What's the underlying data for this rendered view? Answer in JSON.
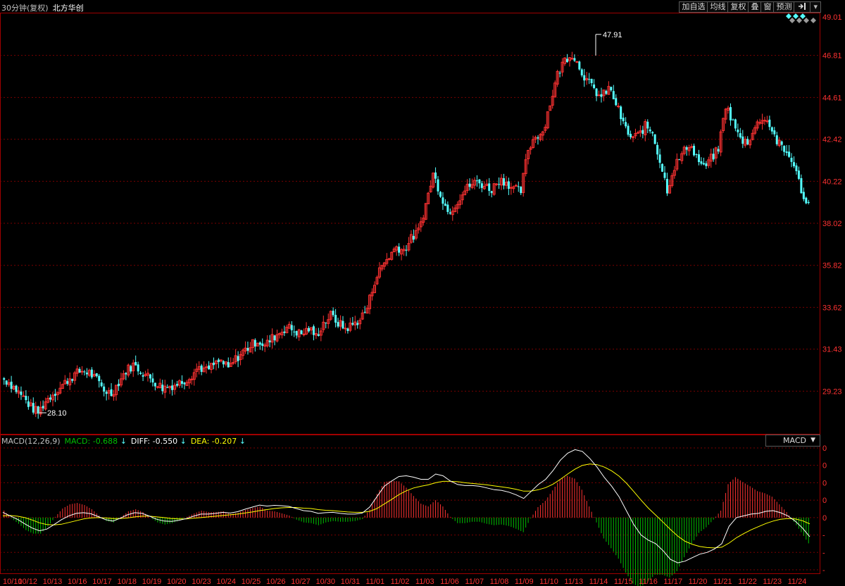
{
  "header": {
    "period": "30分钟(复权)",
    "stock_name": "北方华创",
    "buttons": [
      "加自选",
      "均线",
      "复权",
      "叠",
      "窗",
      "预测"
    ],
    "arrow_icon": "exit-arrow-icon",
    "menu_icon": "dropdown-triangle-icon"
  },
  "colors": {
    "up": "#ff3232",
    "down": "#54ffff",
    "grid": "#7a0000",
    "axis_text": "#ff3232",
    "dates_text": "#ff3232",
    "diff": "#ffffff",
    "dea": "#ffff00",
    "macd_pos": "#ff3232",
    "macd_neg": "#00c000"
  },
  "macd_header": {
    "name": "MACD(12,26,9)",
    "macd_label": "MACD: -0.688",
    "diff_label": "DIFF: -0.550",
    "dea_label": "DEA: -0.207",
    "down_arrow": "↓",
    "selector": "MACD"
  },
  "annotations": {
    "high_label": "47.91",
    "low_label": "28.10"
  },
  "chart_data": [
    {
      "type": "candlestick",
      "title": "30分钟(复权) 北方华创",
      "y_ticks": [
        "49.01",
        "46.81",
        "44.61",
        "42.42",
        "40.22",
        "38.02",
        "35.82",
        "33.62",
        "31.43",
        "29.23"
      ],
      "ylim": [
        27.6,
        49.01
      ],
      "x_ticks": [
        "10/10",
        "10/12",
        "10/13",
        "10/16",
        "10/17",
        "10/18",
        "10/19",
        "10/20",
        "10/23",
        "10/24",
        "10/25",
        "10/26",
        "10/27",
        "10/30",
        "10/31",
        "11/01",
        "11/02",
        "11/03",
        "11/06",
        "11/07",
        "11/08",
        "11/09",
        "11/10",
        "11/13",
        "11/14",
        "11/15",
        "11/16",
        "11/17",
        "11/20",
        "11/21",
        "11/22",
        "11/23",
        "11/24"
      ],
      "grid": true,
      "close_path": [
        29.9,
        29.7,
        29.3,
        28.9,
        28.4,
        28.1,
        28.7,
        29.1,
        29.4,
        29.8,
        30.1,
        30.3,
        30.2,
        29.8,
        29.3,
        29.1,
        29.7,
        30.3,
        30.6,
        30.3,
        30.0,
        29.7,
        29.4,
        29.5,
        29.6,
        29.8,
        30.1,
        30.5,
        30.3,
        30.6,
        30.8,
        30.4,
        30.9,
        31.3,
        31.6,
        31.9,
        31.6,
        32.0,
        32.3,
        32.6,
        32.4,
        32.2,
        32.5,
        32.1,
        32.8,
        33.2,
        32.8,
        32.5,
        32.7,
        33.0,
        33.6,
        35.0,
        35.8,
        36.3,
        36.8,
        36.6,
        37.2,
        37.6,
        39.0,
        40.6,
        39.6,
        38.6,
        39.0,
        39.6,
        40.0,
        40.2,
        40.0,
        39.8,
        40.3,
        40.2,
        39.8,
        39.7,
        41.9,
        42.6,
        42.8,
        44.3,
        45.8,
        46.6,
        46.9,
        46.2,
        45.5,
        45.0,
        44.6,
        45.1,
        44.3,
        43.2,
        42.5,
        42.6,
        43.1,
        42.8,
        41.3,
        39.8,
        41.0,
        41.6,
        42.2,
        41.5,
        40.9,
        41.4,
        41.9,
        44.2,
        43.3,
        42.4,
        42.3,
        43.0,
        43.6,
        43.2,
        42.3,
        41.8,
        41.4,
        40.2,
        39.0
      ],
      "high": 47.91,
      "low": 28.1
    },
    {
      "type": "macd",
      "name": "MACD(12,26,9)",
      "series": [
        {
          "name": "DIFF",
          "values": [
            0.15,
            0.05,
            -0.05,
            -0.18,
            -0.3,
            -0.38,
            -0.33,
            -0.2,
            -0.06,
            0.05,
            0.12,
            0.14,
            0.11,
            0.03,
            -0.06,
            -0.1,
            -0.02,
            0.08,
            0.14,
            0.12,
            0.04,
            -0.05,
            -0.1,
            -0.11,
            -0.08,
            -0.03,
            0.04,
            0.1,
            0.1,
            0.12,
            0.15,
            0.13,
            0.17,
            0.24,
            0.3,
            0.36,
            0.33,
            0.35,
            0.34,
            0.32,
            0.26,
            0.2,
            0.18,
            0.12,
            0.14,
            0.15,
            0.12,
            0.1,
            0.1,
            0.13,
            0.3,
            0.6,
            0.9,
            1.05,
            1.18,
            1.2,
            1.16,
            1.1,
            1.1,
            1.25,
            1.2,
            1.05,
            0.95,
            0.92,
            0.92,
            0.9,
            0.85,
            0.8,
            0.78,
            0.73,
            0.65,
            0.55,
            0.75,
            0.95,
            1.1,
            1.35,
            1.65,
            1.85,
            1.95,
            1.9,
            1.7,
            1.45,
            1.15,
            0.9,
            0.6,
            0.2,
            -0.2,
            -0.5,
            -0.65,
            -0.75,
            -0.95,
            -1.2,
            -1.3,
            -1.25,
            -1.15,
            -1.05,
            -1.0,
            -0.9,
            -0.75,
            -0.25,
            0.0,
            0.05,
            0.1,
            0.12,
            0.18,
            0.2,
            0.14,
            0.05,
            -0.1,
            -0.3,
            -0.55
          ]
        },
        {
          "name": "DEA",
          "values": [
            0.05,
            0.06,
            0.04,
            0.0,
            -0.07,
            -0.15,
            -0.2,
            -0.21,
            -0.19,
            -0.14,
            -0.09,
            -0.04,
            -0.01,
            0.0,
            -0.01,
            -0.03,
            -0.03,
            -0.01,
            0.02,
            0.04,
            0.04,
            0.02,
            0.0,
            -0.03,
            -0.04,
            -0.04,
            -0.02,
            0.0,
            0.02,
            0.04,
            0.06,
            0.08,
            0.1,
            0.13,
            0.16,
            0.2,
            0.23,
            0.26,
            0.28,
            0.29,
            0.29,
            0.27,
            0.26,
            0.23,
            0.21,
            0.2,
            0.18,
            0.16,
            0.15,
            0.15,
            0.18,
            0.26,
            0.39,
            0.52,
            0.66,
            0.77,
            0.85,
            0.9,
            0.94,
            1.0,
            1.04,
            1.04,
            1.03,
            1.0,
            0.98,
            0.96,
            0.94,
            0.91,
            0.88,
            0.85,
            0.81,
            0.76,
            0.76,
            0.8,
            0.86,
            0.96,
            1.1,
            1.25,
            1.39,
            1.5,
            1.54,
            1.52,
            1.45,
            1.34,
            1.19,
            0.99,
            0.75,
            0.5,
            0.27,
            0.07,
            -0.13,
            -0.34,
            -0.53,
            -0.68,
            -0.77,
            -0.83,
            -0.86,
            -0.87,
            -0.85,
            -0.73,
            -0.58,
            -0.46,
            -0.35,
            -0.26,
            -0.17,
            -0.1,
            -0.05,
            -0.03,
            -0.04,
            -0.09,
            -0.18
          ]
        }
      ],
      "latest": {
        "MACD": -0.688,
        "DIFF": -0.55,
        "DEA": -0.207
      }
    }
  ]
}
